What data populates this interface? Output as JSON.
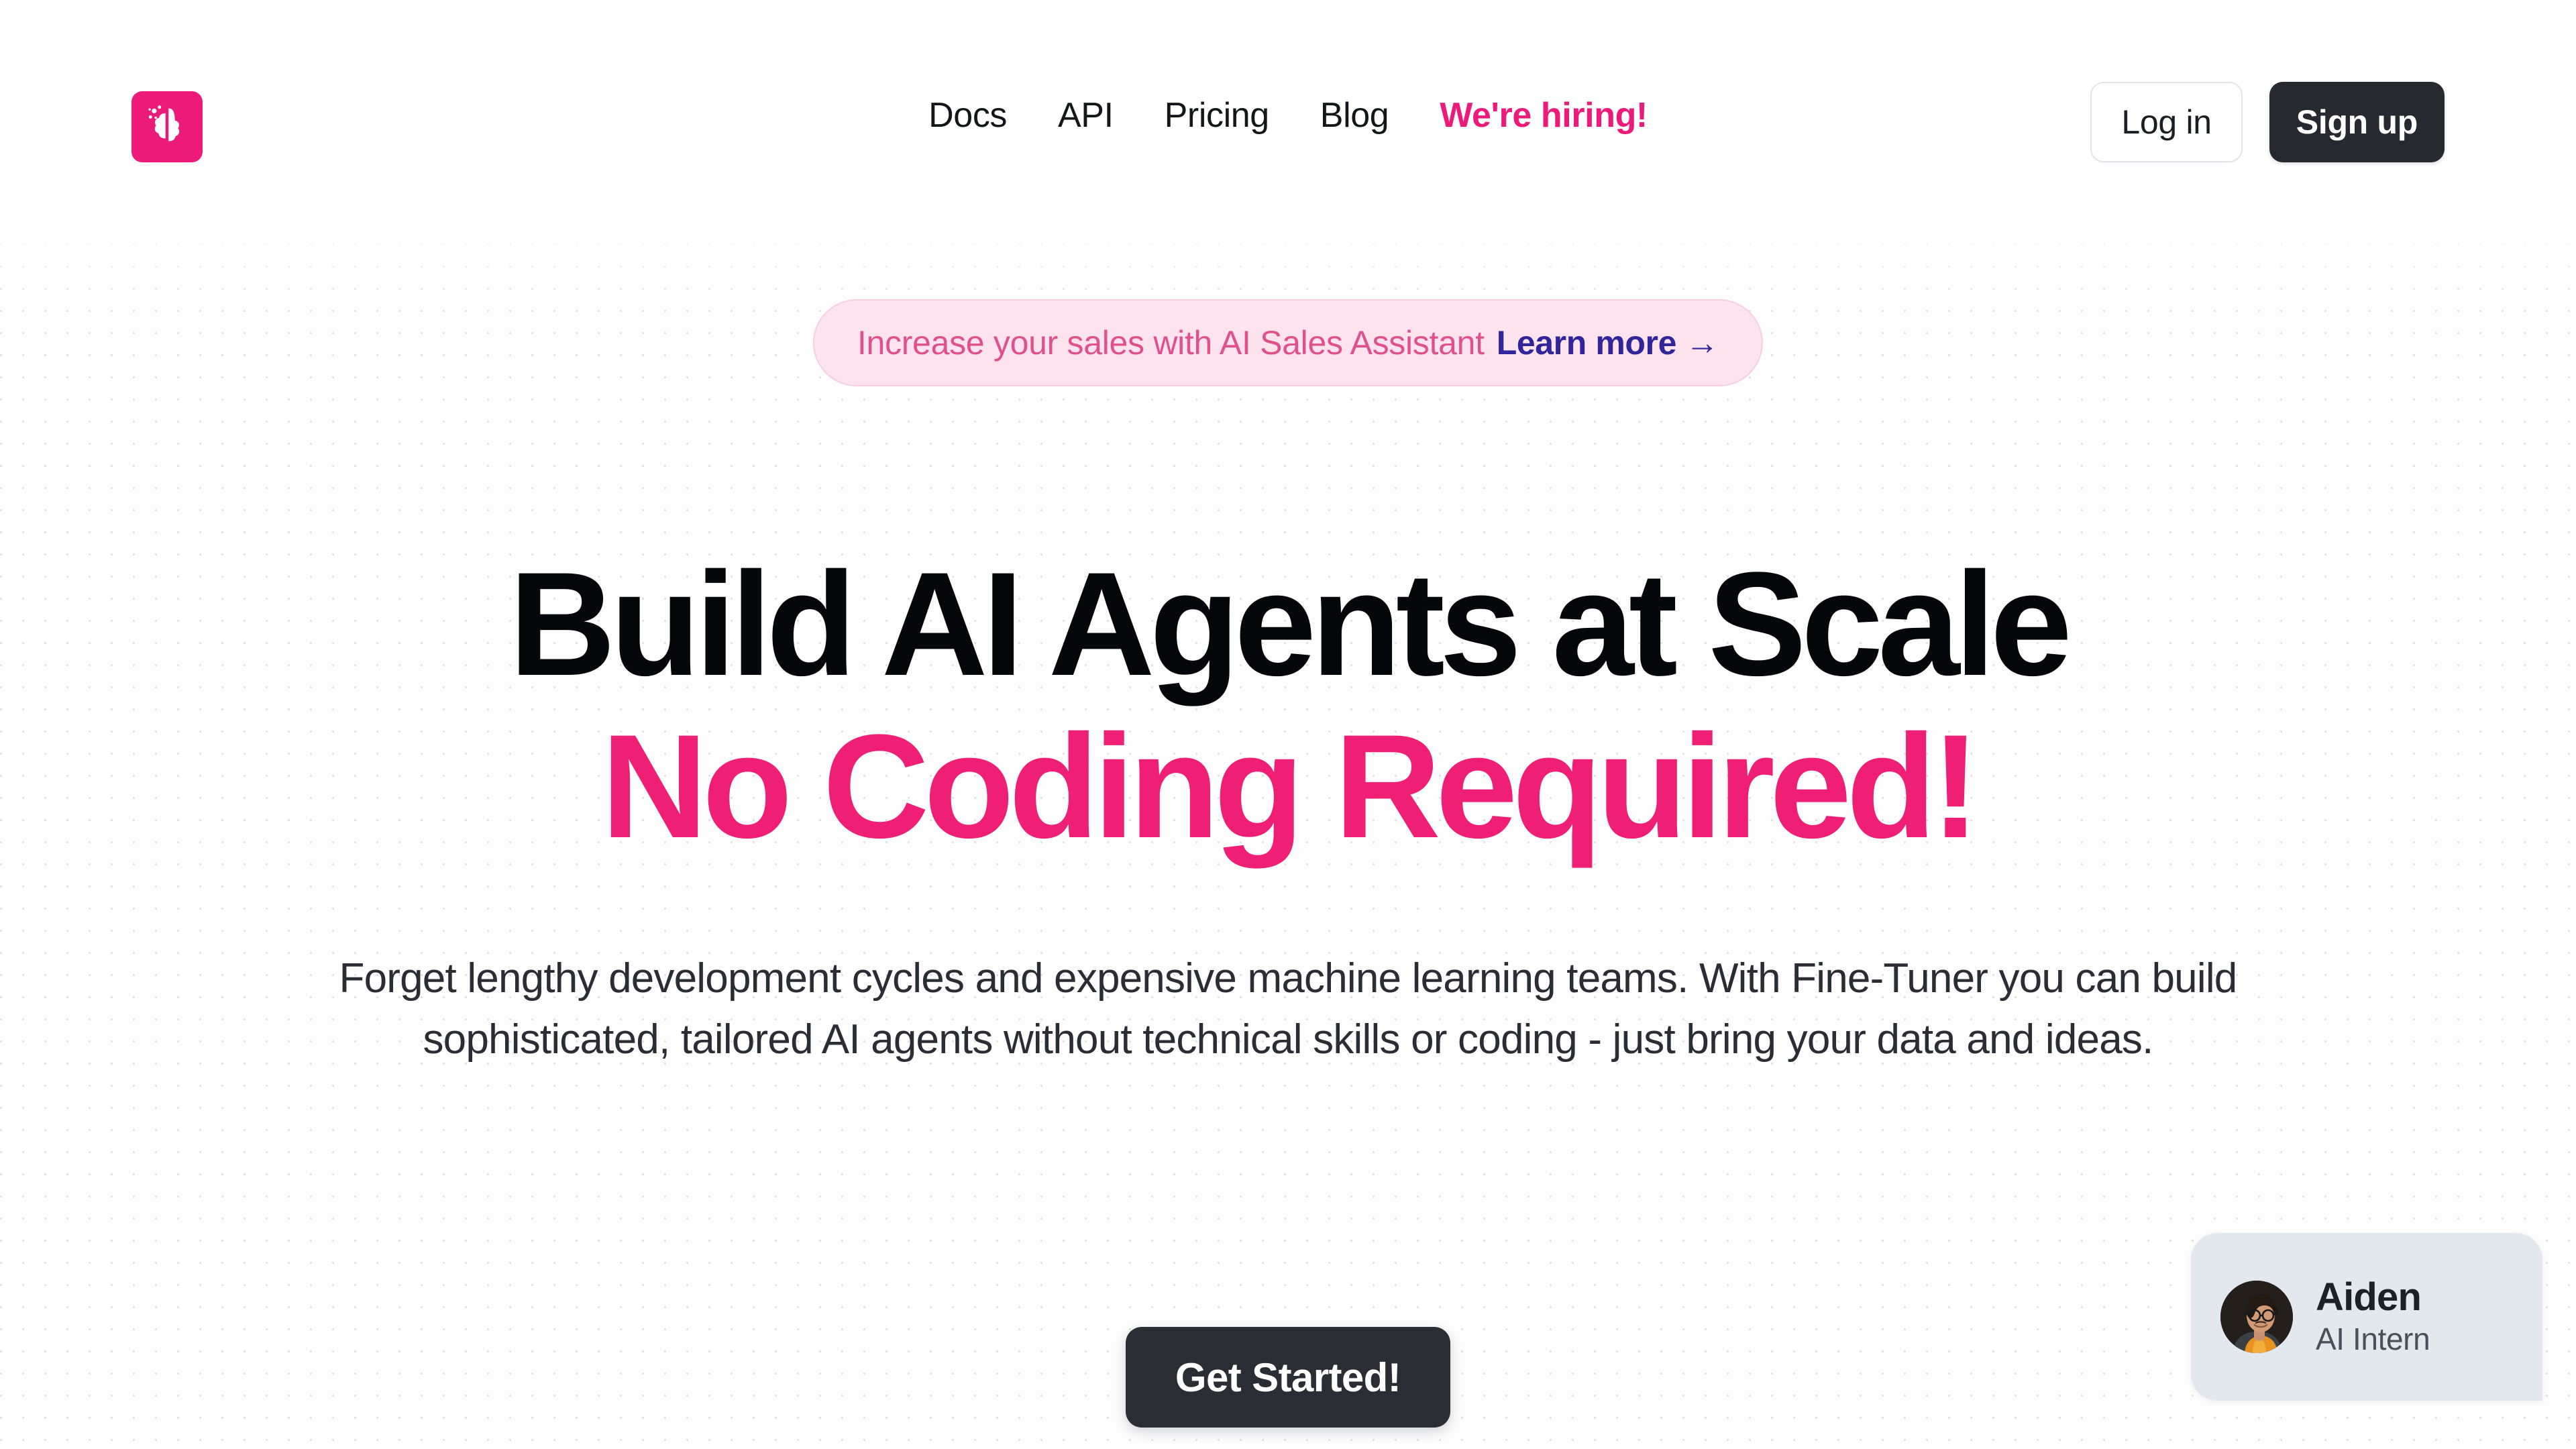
{
  "brand": {
    "logo_icon": "brain-sparkle-icon",
    "logo_color": "#ec1a78"
  },
  "header": {
    "nav": [
      {
        "label": "Docs",
        "accent": false
      },
      {
        "label": "API",
        "accent": false
      },
      {
        "label": "Pricing",
        "accent": false
      },
      {
        "label": "Blog",
        "accent": false
      },
      {
        "label": "We're hiring!",
        "accent": true
      }
    ],
    "login_label": "Log in",
    "signup_label": "Sign up"
  },
  "banner": {
    "text": "Increase your sales with AI Sales Assistant",
    "link": "Learn more →",
    "bg": "#fce3ee",
    "text_color": "#e0518c",
    "link_color": "#32249a"
  },
  "hero": {
    "headline_line1": "Build AI Agents at Scale",
    "headline_line2": "No Coding Required!",
    "headline_line2_color": "#ee1f74",
    "subtitle": "Forget lengthy development cycles and expensive machine learning teams. With Fine-Tuner you can build sophisticated, tailored AI agents without technical skills or coding - just bring your data and ideas.",
    "cta_label": "Get Started!"
  },
  "chat_widget": {
    "name": "Aiden",
    "role": "AI Intern",
    "avatar_icon": "user-photo-avatar",
    "bg": "#e3e8ee"
  }
}
